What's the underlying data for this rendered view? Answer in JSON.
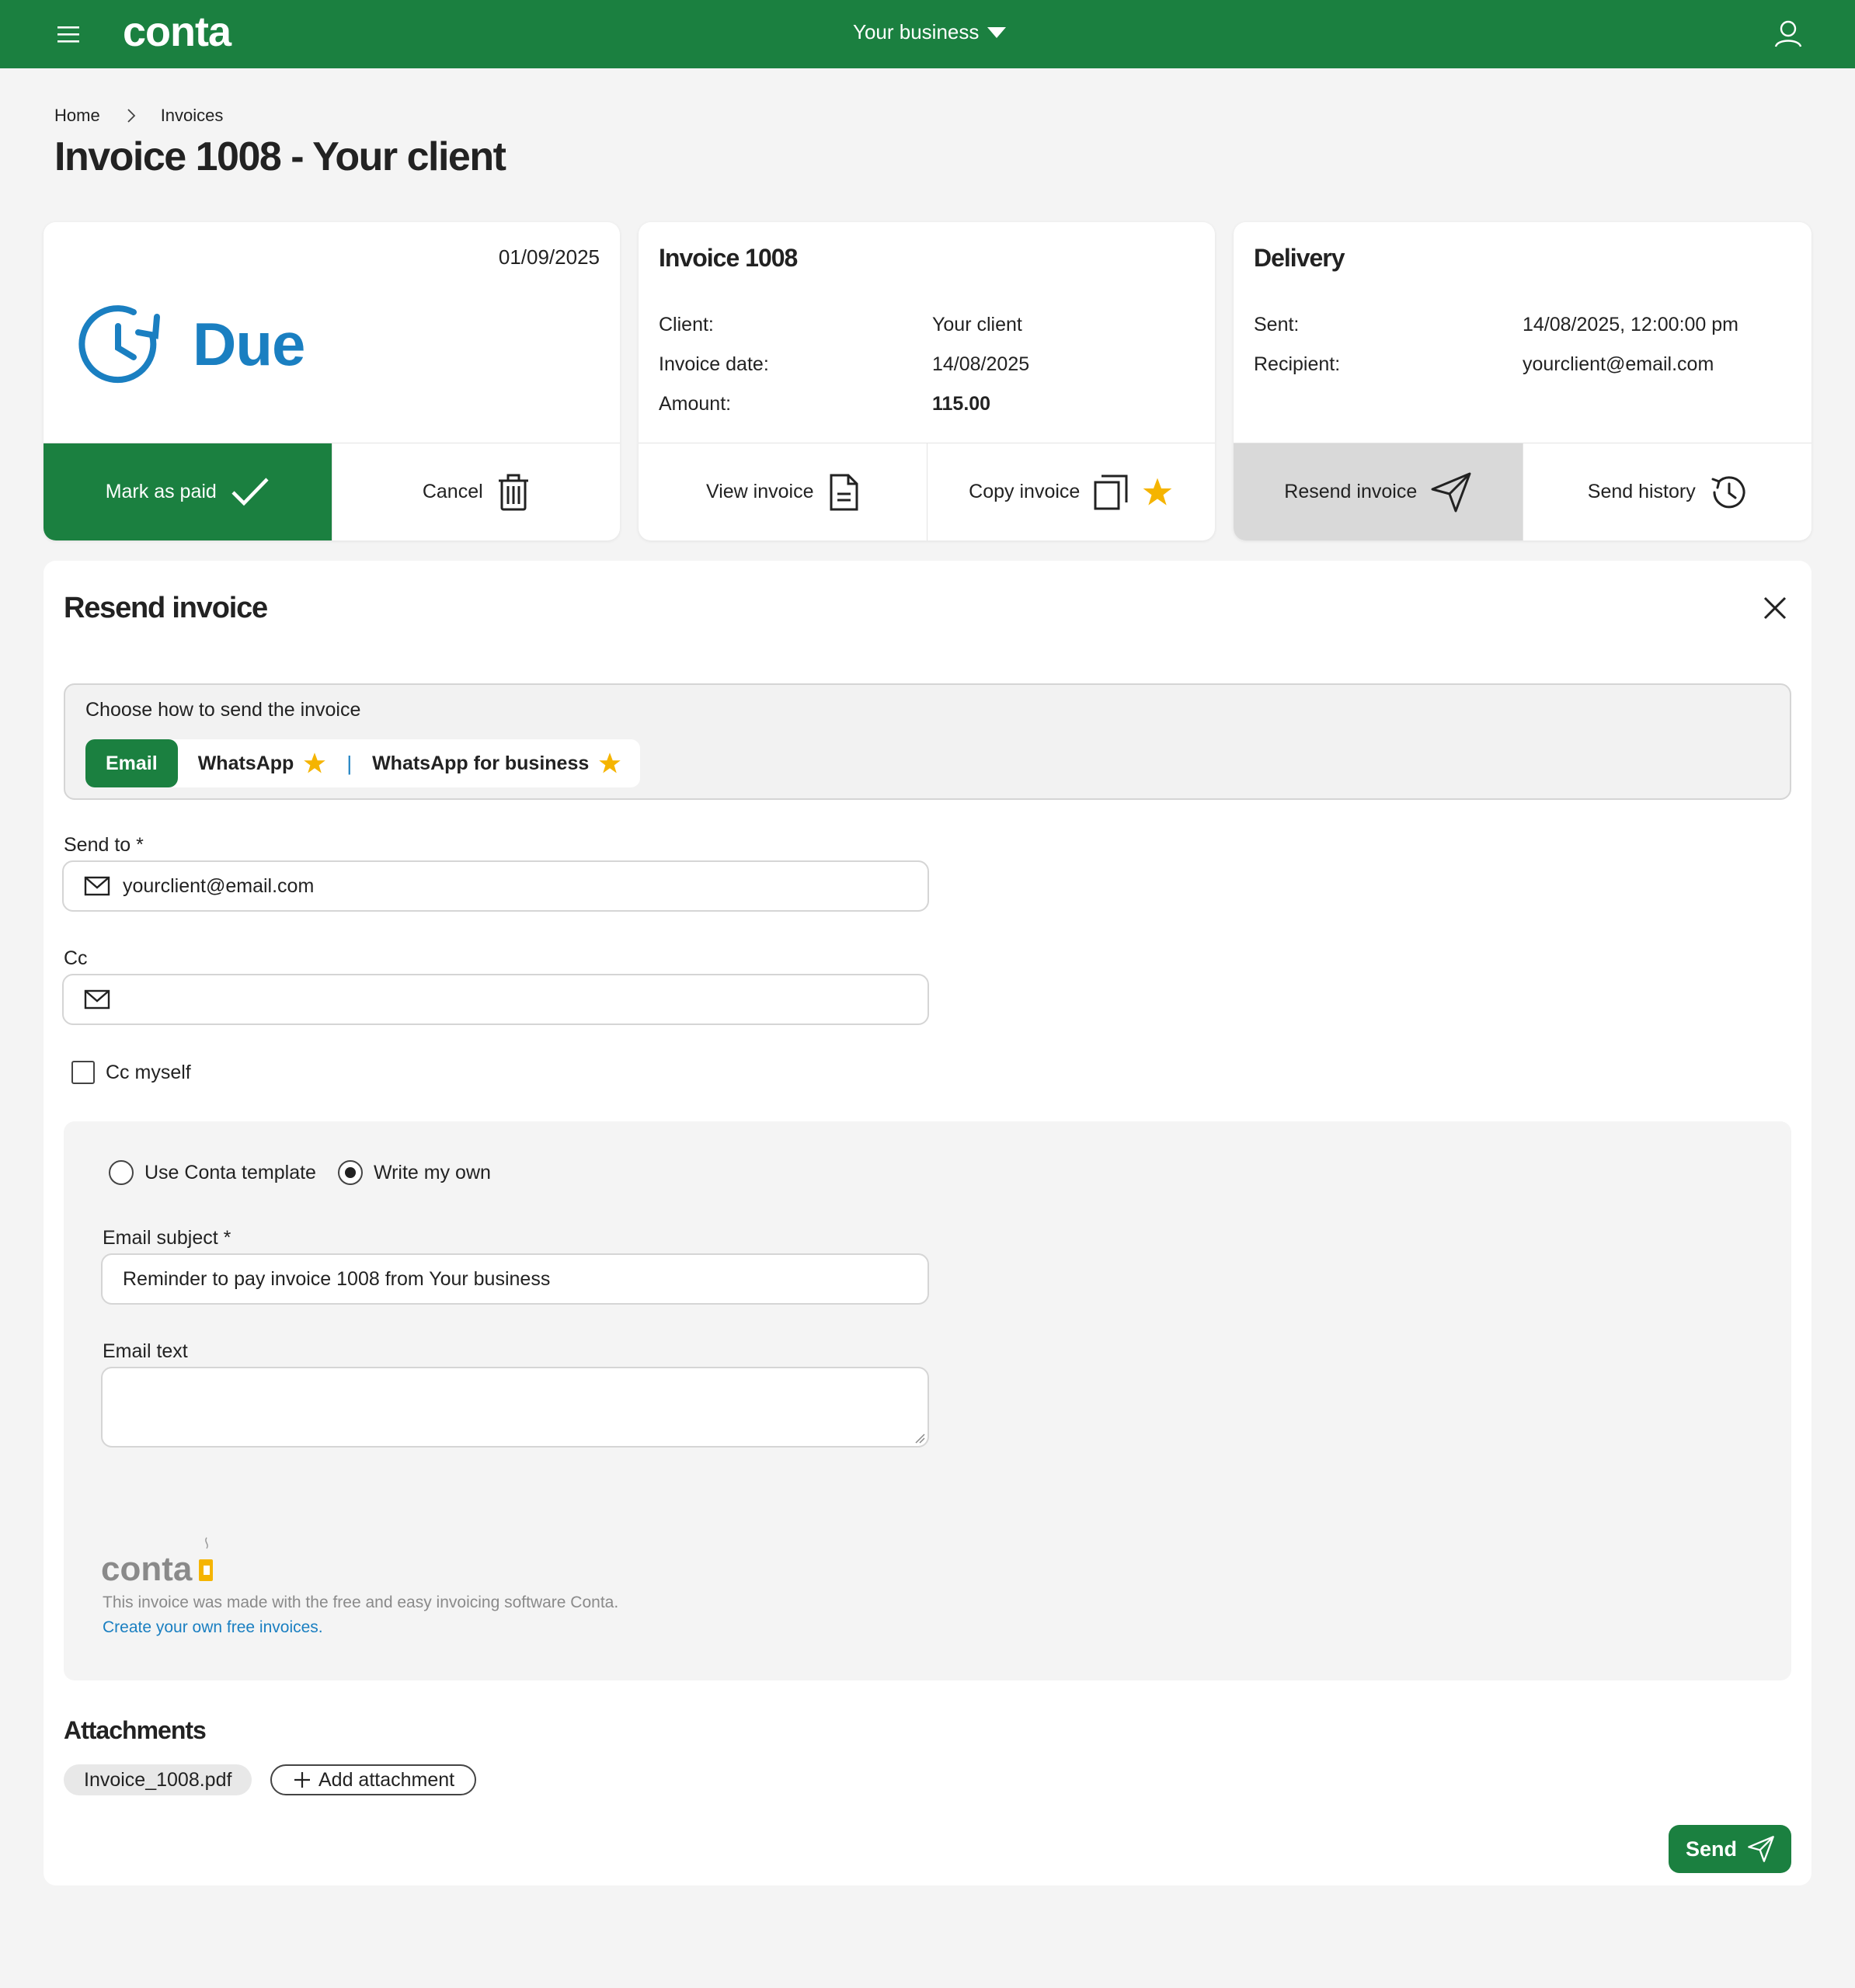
{
  "app": {
    "logo": "conta",
    "business": "Your business"
  },
  "breadcrumb": {
    "home": "Home",
    "current": "Invoices"
  },
  "page_title": "Invoice 1008 - Your client",
  "status_card": {
    "date": "01/09/2025",
    "status": "Due",
    "mark_paid_label": "Mark as paid",
    "cancel_label": "Cancel"
  },
  "invoice_card": {
    "title": "Invoice 1008",
    "client_label": "Client:",
    "client_value": "Your client",
    "date_label": "Invoice date:",
    "date_value": "14/08/2025",
    "amount_label": "Amount:",
    "amount_value": "115.00",
    "view_label": "View invoice",
    "copy_label": "Copy invoice"
  },
  "delivery_card": {
    "title": "Delivery",
    "sent_label": "Sent:",
    "sent_value": "14/08/2025, 12:00:00 pm",
    "recipient_label": "Recipient:",
    "recipient_value": "yourclient@email.com",
    "resend_label": "Resend invoice",
    "history_label": "Send history"
  },
  "resend": {
    "title": "Resend invoice",
    "method_label": "Choose how to send the invoice",
    "methods": {
      "email": "Email",
      "whatsapp": "WhatsApp",
      "whatsapp_business": "WhatsApp for business"
    },
    "send_to_label": "Send to *",
    "send_to_value": "yourclient@email.com",
    "cc_label": "Cc",
    "cc_value": "",
    "cc_myself_label": "Cc myself",
    "template_option": "Use Conta template",
    "own_option": "Write my own",
    "subject_label": "Email subject *",
    "subject_value": "Reminder to pay invoice 1008 from Your business",
    "text_label": "Email text",
    "text_value": "",
    "footer_logo": "conta",
    "footer_note": "This invoice was made with the free and easy invoicing software Conta.",
    "footer_link": "Create your own free invoices.",
    "attachments_title": "Attachments",
    "attachment_file": "Invoice_1008.pdf",
    "add_attachment_label": "Add attachment",
    "send_label": "Send"
  },
  "colors": {
    "brand": "#1b8040",
    "due": "#1a7fc1",
    "star": "#f5b400"
  },
  "icons": [
    "menu-icon",
    "chevron-down-icon",
    "user-icon",
    "chevron-right-icon",
    "clock-icon",
    "check-icon",
    "trash-icon",
    "document-icon",
    "copy-icon",
    "star-icon",
    "send-icon",
    "history-icon",
    "close-icon",
    "mail-icon",
    "plus-icon",
    "coffee-cup-icon"
  ]
}
